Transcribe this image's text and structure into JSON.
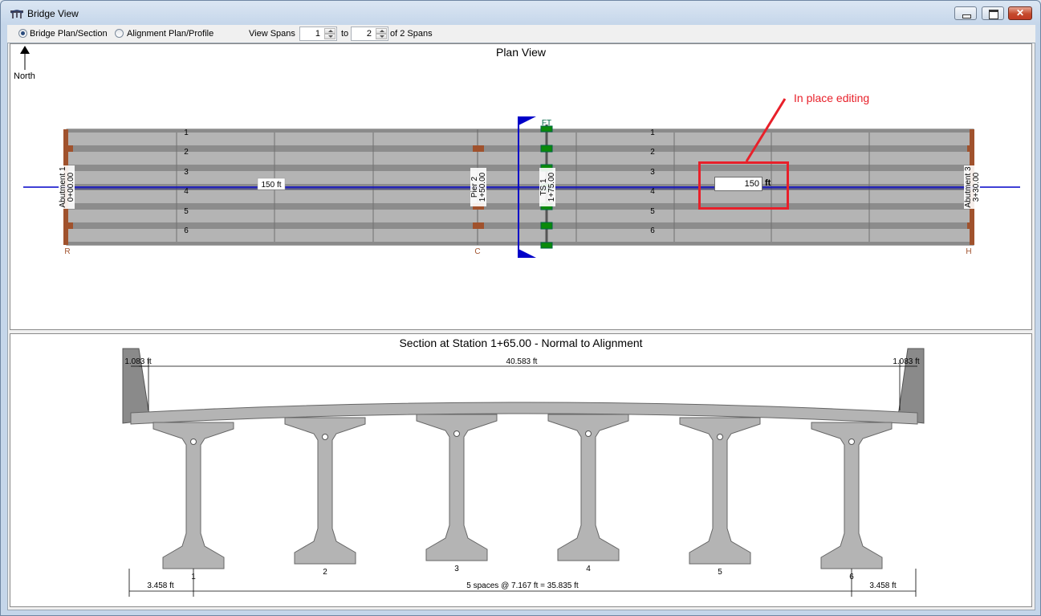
{
  "window": {
    "title": "Bridge View",
    "controls": {
      "minimize": "–",
      "maximize": "□",
      "close": "✕"
    }
  },
  "toolbar": {
    "view_modes": [
      {
        "label": "Bridge Plan/Section",
        "selected": true
      },
      {
        "label": "Alignment Plan/Profile",
        "selected": false
      }
    ],
    "view_spans_label": "View Spans",
    "span_from": "1",
    "to_label": "to",
    "span_to": "2",
    "of_label": "of 2 Spans"
  },
  "plan_view": {
    "title": "Plan View",
    "north_label": "North",
    "girder_lines_span1": [
      "1",
      "2",
      "3",
      "4",
      "5",
      "6"
    ],
    "girder_lines_span2": [
      "1",
      "2",
      "3",
      "4",
      "5",
      "6"
    ],
    "span1_length_label": "150 ft",
    "ft_label": "FT",
    "supports": [
      {
        "name": "Abutment 1",
        "station": "0+00.00",
        "bearing": "R"
      },
      {
        "name": "Pier 2",
        "station": "1+50.00",
        "bearing": "C"
      },
      {
        "name": "Abutment 3",
        "station": "3+30.00",
        "bearing": "H"
      }
    ],
    "splice": {
      "name": "TS 1",
      "station": "1+75.00"
    },
    "edit_field": {
      "value": "150",
      "unit": "ft"
    },
    "callout_text": "In place editing"
  },
  "section_view": {
    "title": "Section at Station 1+65.00 - Normal to Alignment",
    "left_barrier_dim": "1.083 ft",
    "deck_width_dim": "40.583 ft",
    "right_barrier_dim": "1.083 ft",
    "girder_labels": [
      "1",
      "2",
      "3",
      "4",
      "5",
      "6"
    ],
    "left_overhang_dim": "3.458 ft",
    "spacing_dim": "5 spaces @ 7.167 ft = 35.835 ft",
    "right_overhang_dim": "3.458 ft"
  },
  "colors": {
    "deck": "#b4b4b4",
    "girder_line": "#7a7a7a",
    "alignment": "#0000c8",
    "bearing": "#a0522d",
    "splice": "#008000",
    "highlight": "#e8202a"
  }
}
